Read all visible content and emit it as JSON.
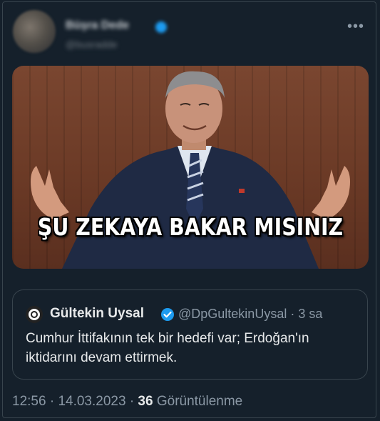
{
  "header": {
    "display_name": "Büşra Dede",
    "handle": "@busradde",
    "more_icon": "more-horizontal-icon"
  },
  "media": {
    "caption": "ŞU ZEKAYA BAKAR MISINIZ"
  },
  "quote": {
    "name": "Gültekin Uysal",
    "handle": "@DpGultekinUysal",
    "separator": "·",
    "time": "3 sa",
    "text": "Cumhur İttifakının tek bir hedefi var; Erdoğan'ın iktidarını devam ettirmek.",
    "verified_color": "#1d9bf0"
  },
  "meta": {
    "time": "12:56",
    "sep1": "·",
    "date": "14.03.2023",
    "sep2": "·",
    "views": "36",
    "views_label": "Görüntülenme"
  },
  "colors": {
    "background": "#15202b",
    "border": "#38444d",
    "secondary_text": "#8b98a5",
    "primary_text": "#e7e9ea"
  }
}
